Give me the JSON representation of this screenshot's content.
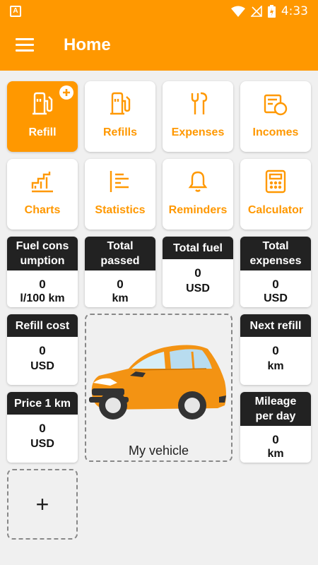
{
  "status_bar": {
    "time": "4:33",
    "app_icon": "A"
  },
  "app_bar": {
    "title": "Home",
    "menu_icon": "hamburger-icon"
  },
  "colors": {
    "accent": "#ff9800",
    "header": "#222222",
    "background": "#f0f0f0"
  },
  "tiles": [
    {
      "label": "Refill",
      "icon": "fuel-pump-icon",
      "active": true
    },
    {
      "label": "Refills",
      "icon": "fuel-pump-icon"
    },
    {
      "label": "Expenses",
      "icon": "wrench-icon"
    },
    {
      "label": "Incomes",
      "icon": "wallet-icon"
    },
    {
      "label": "Charts",
      "icon": "chart-icon"
    },
    {
      "label": "Statistics",
      "icon": "list-icon"
    },
    {
      "label": "Reminders",
      "icon": "bell-icon"
    },
    {
      "label": "Calculator",
      "icon": "calculator-icon"
    }
  ],
  "stats": {
    "fuel_consumption": {
      "title1": "Fuel cons",
      "title2": "umption",
      "value": "0",
      "unit": "l/100 km"
    },
    "total_passed": {
      "title1": "Total",
      "title2": "passed",
      "value": "0",
      "unit": "km"
    },
    "total_fuel": {
      "title1": "Total fuel",
      "value": "0",
      "unit": "USD"
    },
    "total_expenses": {
      "title1": "Total",
      "title2": "expenses",
      "value": "0",
      "unit": "USD"
    },
    "refill_cost": {
      "title1": "Refill cost",
      "value": "0",
      "unit": "USD"
    },
    "next_refill": {
      "title1": "Next refill",
      "value": "0",
      "unit": "km"
    },
    "price_1km": {
      "title1": "Price 1 km",
      "value": "0",
      "unit": "USD"
    },
    "mileage_per_day": {
      "title1": "Mileage",
      "title2": "per day",
      "value": "0",
      "unit": "km"
    }
  },
  "vehicle": {
    "name": "My vehicle"
  },
  "add_widget": {
    "label": "+"
  }
}
